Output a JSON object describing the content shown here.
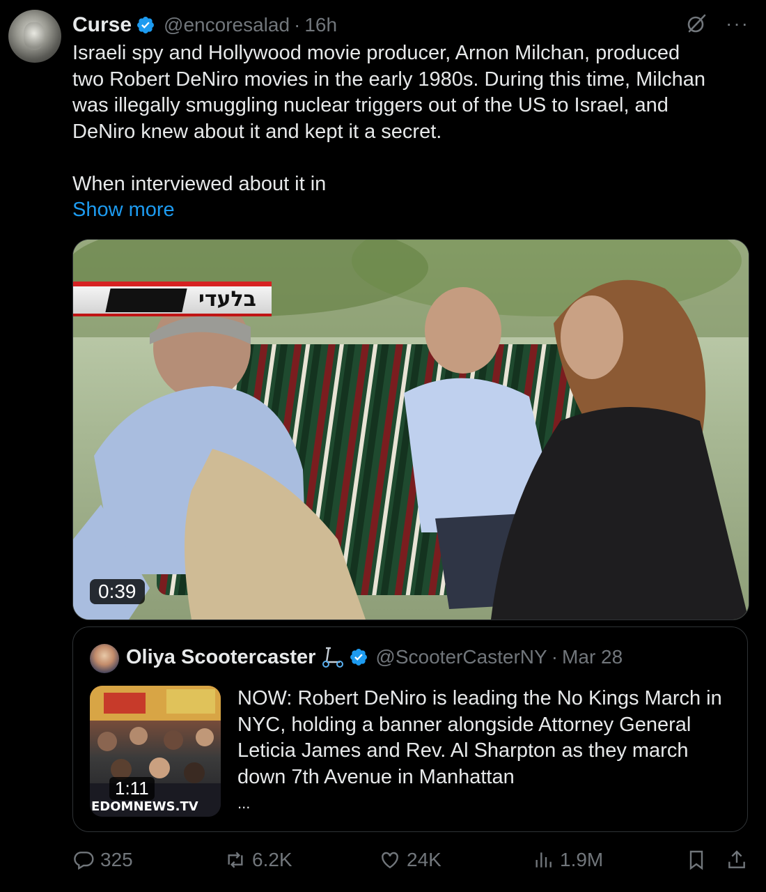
{
  "tweet": {
    "author_name": "Curse",
    "author_handle": "@encoresalad",
    "separator": "·",
    "time": "16h",
    "text_lines": [
      "Israeli spy and Hollywood movie producer, Arnon Milchan, produced",
      "two Robert DeNiro movies in the early 1980s. During this time, Milchan",
      "was illegally smuggling nuclear triggers out of the US to Israel, and",
      "DeNiro knew about it and kept it a secret."
    ],
    "text_line_2": "When interviewed about it in",
    "show_more": "Show more",
    "more_icon": "···"
  },
  "media": {
    "duration": "0:39",
    "channel_text": "בלעדי"
  },
  "quote": {
    "author_name": "Oliya Scootercaster",
    "author_handle": "@ScooterCasterNY",
    "separator": "·",
    "date": "Mar 28",
    "text": "NOW: Robert DeNiro is leading the No Kings March in NYC, holding a banner alongside Attorney General Leticia James and Rev. Al Sharpton as they march down 7th Avenue in Manhattan",
    "ellipsis": "...",
    "thumb_duration": "1:11",
    "thumb_brand": "EDOMNEWS.TV"
  },
  "actions": {
    "replies": "325",
    "retweets": "6.2K",
    "likes": "24K",
    "views": "1.9M"
  },
  "colors": {
    "background": "#000000",
    "text": "#e7e9ea",
    "muted": "#71767b",
    "accent": "#1d9bf0",
    "border": "#2f3336"
  }
}
